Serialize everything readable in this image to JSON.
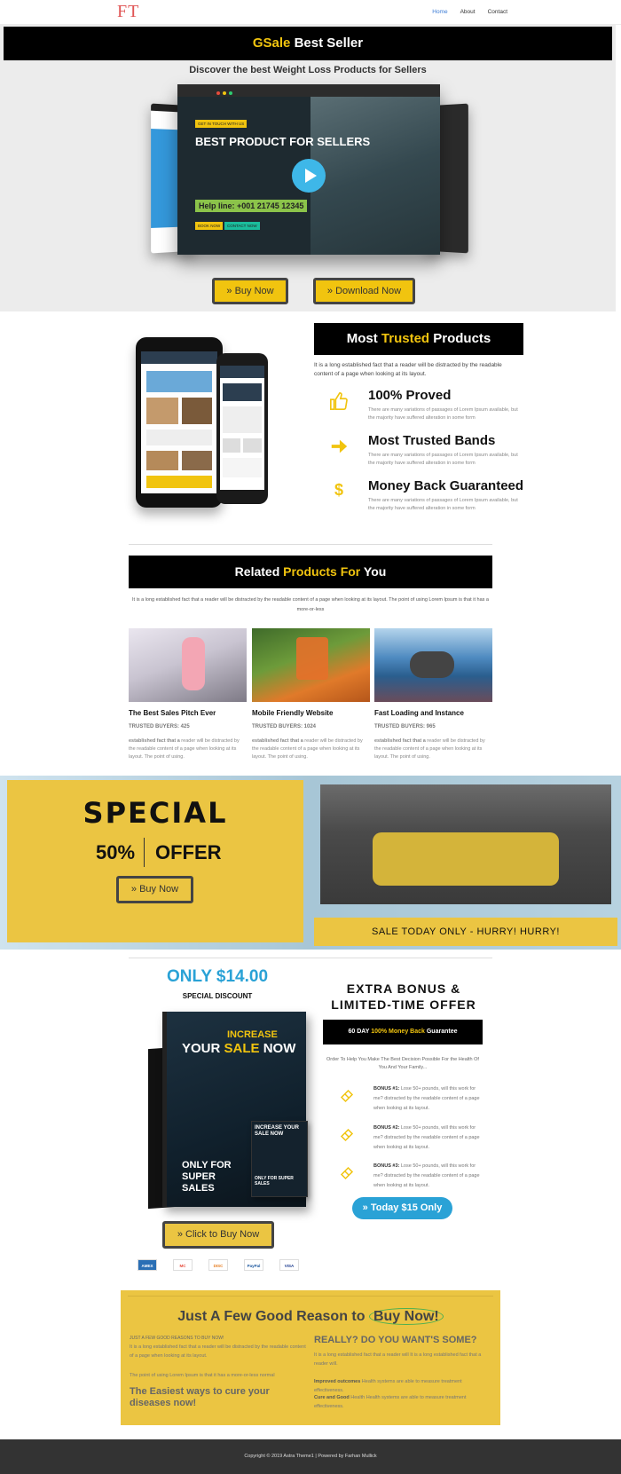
{
  "nav": {
    "logo": "FT",
    "links": [
      "Home",
      "About",
      "Contact"
    ]
  },
  "hero": {
    "banner_brand": "GSale",
    "banner_rest": " Best Seller",
    "subtitle": "Discover the best Weight Loss Products for Sellers",
    "mockup": {
      "tag": "GET IN TOUCH WITH US",
      "title": "BEST PRODUCT FOR SELLERS",
      "help": "Help line: +001 21745 12345",
      "btn_book": "BOOK NOW",
      "btn_contact": "CONTACT NOW"
    },
    "buy_btn": "» Buy Now",
    "download_btn": "» Download Now"
  },
  "trusted": {
    "head_a": "Most ",
    "head_b": "Trusted",
    "head_c": " Products",
    "desc": "It is a long established fact that a reader will be distracted by the readable content of a page when looking at its layout.",
    "features": [
      {
        "icon": "thumbs-up-icon",
        "title": "100% Proved",
        "text": "There are many variations of passages of Lorem Ipsum available, but the majority have suffered alteration in some form"
      },
      {
        "icon": "arrow-right-icon",
        "title": "Most Trusted Bands",
        "text": "There are many variations of passages of Lorem Ipsum available, but the majority have suffered alteration in some form"
      },
      {
        "icon": "dollar-icon",
        "title": "Money Back Guaranteed",
        "text": "There are many variations of passages of Lorem Ipsum available, but the majority have suffered alteration in some form"
      }
    ]
  },
  "related": {
    "head_a": "Related ",
    "head_b": "Products For",
    "head_c": " You",
    "desc": "It is a long established fact that a reader will be distracted by the readable content of a page when looking at its layout. The point of using Lorem Ipsum is that it has a more-or-less",
    "cards": [
      {
        "title": "The Best Sales Pitch Ever",
        "buyers": "TRUSTED BUYERS: 425",
        "text_bold": "established fact that a",
        "text": " reader will be distracted by the readable content of a page when looking at its layout. The point of using."
      },
      {
        "title": "Mobile Friendly Website",
        "buyers": "TRUSTED BUYERS: 1024",
        "text_bold": "established fact that a",
        "text": " reader will be distracted by the readable content of a page when looking at its layout. The point of using."
      },
      {
        "title": "Fast Loading and Instance",
        "buyers": "TRUSTED BUYERS: 965",
        "text_bold": "established fact that a",
        "text": " reader will be distracted by the readable content of a page when looking at its layout. The point of using."
      }
    ]
  },
  "special": {
    "title": "SPECIAL",
    "percent": "50%",
    "offer": "OFFER",
    "btn": "» Buy Now",
    "sale_bar": "SALE TODAY ONLY - HURRY! HURRY!"
  },
  "offer": {
    "price": "ONLY $14.00",
    "discount": "SPECIAL DISCOUNT",
    "book_top": "INCREASE",
    "book_title_a": "YOUR ",
    "book_title_b": "SALE",
    "book_title_c": " NOW",
    "book_only": "ONLY FOR SUPER SALES",
    "book_small_title": "INCREASE YOUR SALE NOW",
    "book_small_only": "ONLY FOR SUPER SALES",
    "buy_btn": "» Click to Buy Now",
    "payments": [
      "AMEX",
      "MC",
      "DISC",
      "PayPal",
      "VISA"
    ],
    "extra_title": "EXTRA BONUS & LIMITED-TIME OFFER",
    "guarantee_a": "60 DAY ",
    "guarantee_b": "100% Money Back",
    "guarantee_c": " Guarantee",
    "order_text": "Order To Help You Make The Best Decision Possible For the Health Of You And Your Family...",
    "bonuses": [
      {
        "label": "BONUS #1:",
        "text": " Lose 50+ pounds, will this work for me? distracted by the readable content of a page when looking at its layout."
      },
      {
        "label": "BONUS #2:",
        "text": " Lose 50+ pounds, will this work for me? distracted by the readable content of a page when looking at its layout."
      },
      {
        "label": "BONUS #3:",
        "text": " Lose 50+ pounds, will this work for me? distracted by the readable content of a page when looking at its layout."
      }
    ],
    "today_btn": "» Today $15 Only"
  },
  "reasons": {
    "title_a": "Just A Few Good Reason to ",
    "title_b": "Buy Now!",
    "left_small": "JUST A FEW GOOD REASONS TO BUY NOW!",
    "left_text": "It is a long established fact that a reader will be distracted by the readable content of a page when looking at its layout.",
    "left_text2": "The point of using Lorem Ipsum is that it has a more-or-less normal",
    "left_head": "The Easiest ways to cure your diseases now!",
    "right_head": "REALLY? DO YOU WANT'S SOME?",
    "right_text": "It is a long established fact that a reader will It is a long established fact that a reader will.",
    "right_b1": "Improved outcomes",
    "right_t1": " Health systems are able to measure treatment effectiveness.",
    "right_b2": "Cure and Good",
    "right_t2": " Health Health systems are able to measure treatment effectiveness."
  },
  "footer": {
    "text": "Copyright © 2019 Astra Theme1 | Powered by Farhan Mullick"
  }
}
